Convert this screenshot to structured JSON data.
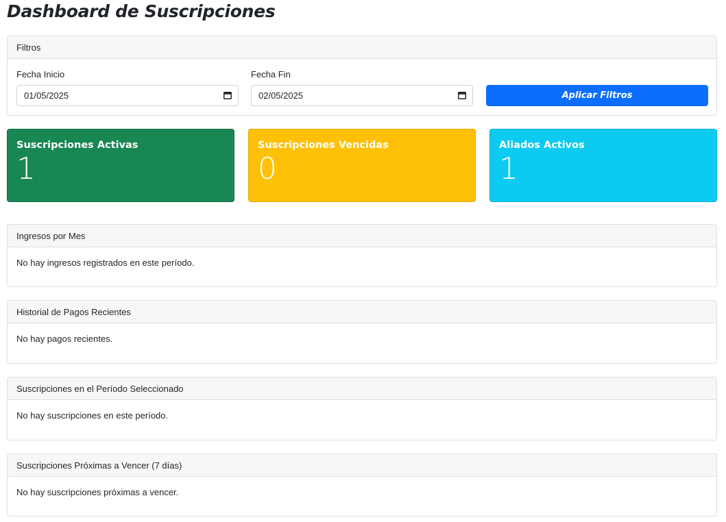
{
  "page": {
    "title": "Dashboard de Suscripciones"
  },
  "filters": {
    "header": "Filtros",
    "start_label": "Fecha Inicio",
    "start_value": "01/05/2025",
    "end_label": "Fecha Fin",
    "end_value": "02/05/2025",
    "apply_label": "Aplicar Filtros"
  },
  "stats": [
    {
      "title": "Suscripciones Activas",
      "value": "1",
      "color": "#198754"
    },
    {
      "title": "Suscripciones Vencidas",
      "value": "0",
      "color": "#ffc107"
    },
    {
      "title": "Aliados Activos",
      "value": "1",
      "color": "#0dcaf0"
    }
  ],
  "sections": [
    {
      "header": "Ingresos por Mes",
      "message": "No hay ingresos registrados en este período."
    },
    {
      "header": "Historial de Pagos Recientes",
      "message": "No hay pagos recientes."
    },
    {
      "header": "Suscripciones en el Período Seleccionado",
      "message": "No hay suscripciones en este período."
    },
    {
      "header": "Suscripciones Próximas a Vencer (7 días)",
      "message": "No hay suscripciones próximas a vencer."
    }
  ],
  "icons": {
    "date_picker": "calendar-icon"
  },
  "colors": {
    "primary": "#0d6efd"
  }
}
